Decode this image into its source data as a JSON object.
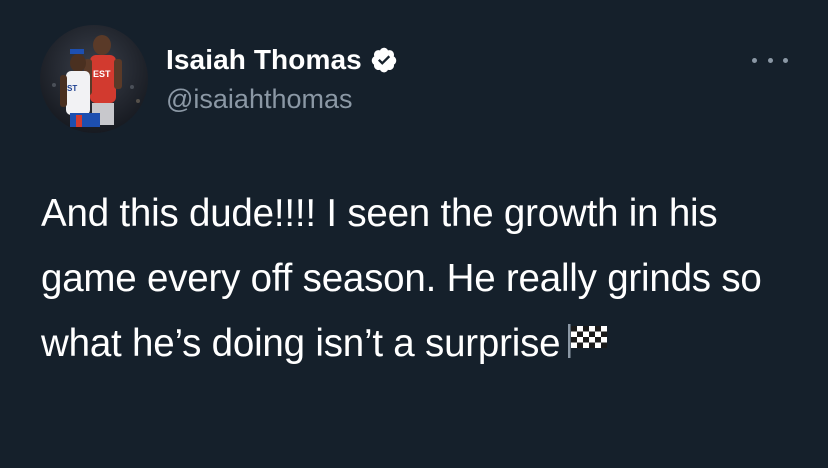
{
  "tweet": {
    "author": {
      "display_name": "Isaiah Thomas",
      "handle": "@isaiahthomas",
      "verified": true
    },
    "text": "And this dude!!!! I seen the growth in his game every off season. He really grinds so what he’s doing isn’t a surprise",
    "emoji": "chequered-flag"
  },
  "colors": {
    "background": "#15202b",
    "text_primary": "#ffffff",
    "text_secondary": "#8b98a5",
    "verified_badge": "#ffffff"
  },
  "icons": {
    "more": "more-options-icon",
    "verified": "verified-badge-icon",
    "emoji": "chequered-flag-icon"
  }
}
